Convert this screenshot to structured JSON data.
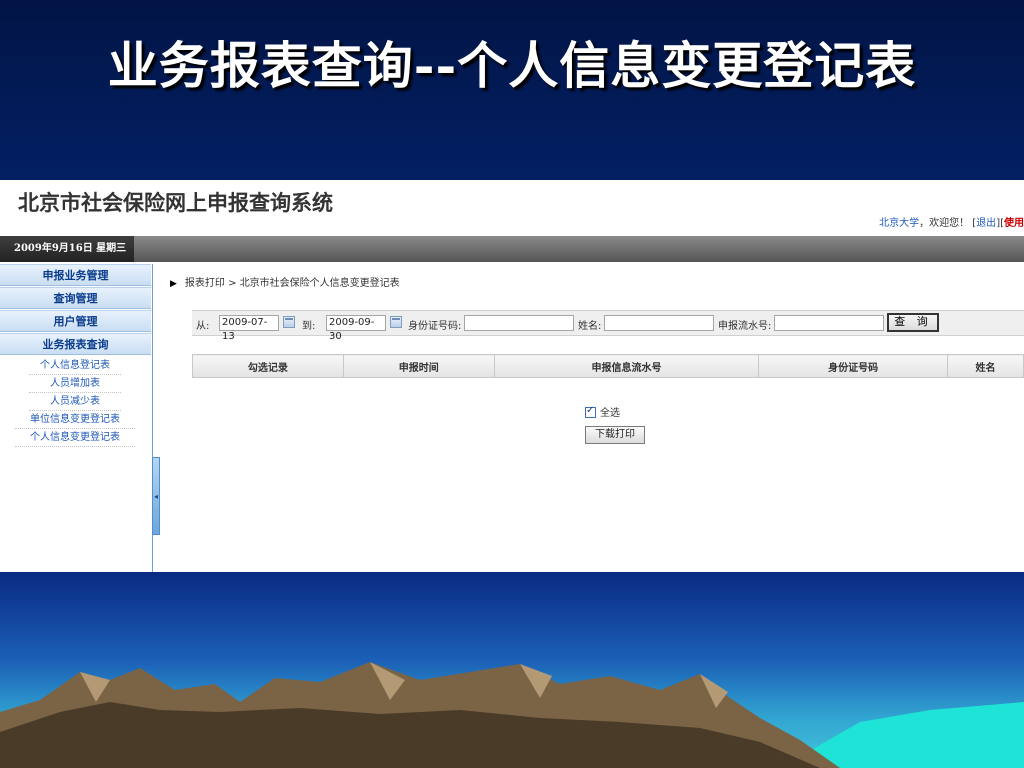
{
  "slide": {
    "title": "业务报表查询--个人信息变更登记表"
  },
  "app": {
    "system_name": "北京市社会保险网上申报查询系统",
    "user_org": "北京大学",
    "welcome_text": "，欢迎您！",
    "logout_label": "退出",
    "help_label": "使用",
    "date_text": "2009年9月16日 星期三"
  },
  "sidebar": {
    "menus": [
      {
        "label": "申报业务管理"
      },
      {
        "label": "查询管理"
      },
      {
        "label": "用户管理"
      },
      {
        "label": "业务报表查询"
      }
    ],
    "submenu": [
      {
        "label": "个人信息登记表"
      },
      {
        "label": "人员增加表"
      },
      {
        "label": "人员减少表"
      },
      {
        "label": "单位信息变更登记表"
      },
      {
        "label": "个人信息变更登记表"
      }
    ]
  },
  "breadcrumb": {
    "section": "报表打印",
    "separator": ">",
    "page": "北京市社会保险个人信息变更登记表"
  },
  "filters": {
    "from_label": "从:",
    "from_value": "2009-07-13",
    "to_label": "到:",
    "to_value": "2009-09-30",
    "id_label": "身份证号码:",
    "id_value": "",
    "name_label": "姓名:",
    "name_value": "",
    "serial_label": "申报流水号:",
    "serial_value": "",
    "query_label": "查 询"
  },
  "table": {
    "columns": [
      "勾选记录",
      "申报时间",
      "申报信息流水号",
      "身份证号码",
      "姓名"
    ]
  },
  "actions": {
    "select_all_label": "全选",
    "select_all_checked": true,
    "print_label": "下载打印"
  }
}
